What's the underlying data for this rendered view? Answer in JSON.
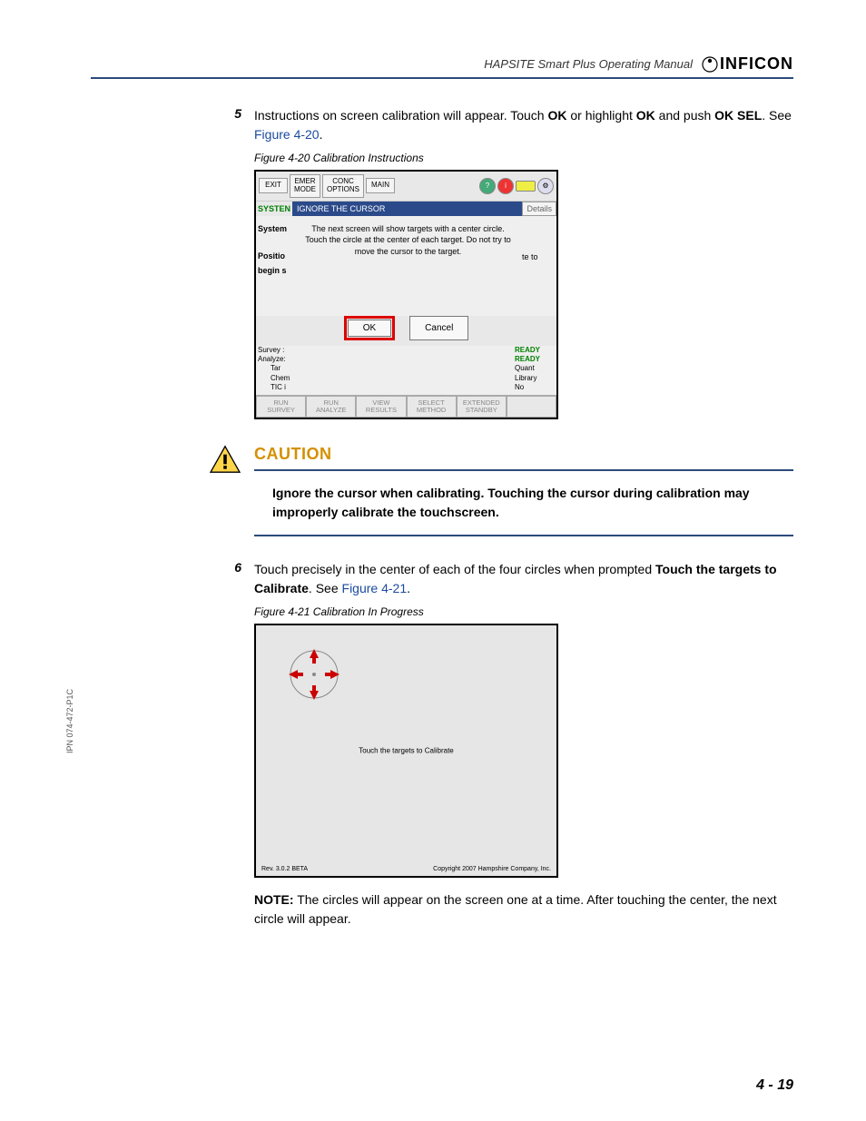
{
  "header": {
    "manual_title": "HAPSITE Smart Plus Operating Manual",
    "logo_text": "INFICON"
  },
  "step5": {
    "num": "5",
    "text_before": "Instructions on screen calibration will appear. Touch ",
    "bold1": "OK",
    "text_mid1": " or highlight ",
    "bold2": "OK",
    "text_mid2": " and push ",
    "bold3": "OK SEL",
    "text_end": ". See ",
    "ref": "Figure 4-20",
    "period": "."
  },
  "fig20_caption": "Figure 4-20  Calibration Instructions",
  "shot1": {
    "top": {
      "exit": "EXIT",
      "emer": "EMER\nMODE",
      "conc": "CONC\nOPTIONS",
      "main": "MAIN"
    },
    "systen": "SYSTEN",
    "ignore": "IGNORE THE CURSOR",
    "details": "Details",
    "left": {
      "l1": "System",
      "l2": "Positio",
      "l3": "begin s"
    },
    "msg": "The next screen will show targets with a center circle. Touch the circle at the center of each target. Do not try to move the cursor to the target.",
    "right_frag": "te to",
    "ok": "OK",
    "cancel": "Cancel",
    "status": {
      "survey": "Survey :",
      "analyze": "Analyze:",
      "tar": "Tar",
      "chem": "Chem",
      "tic": "TIC i",
      "ready1": "READY",
      "ready2": "READY",
      "quant": "Quant",
      "library": "Library",
      "no": "No"
    },
    "bottom": {
      "b1": "RUN\nSURVEY",
      "b2": "RUN\nANALYZE",
      "b3": "VIEW\nRESULTS",
      "b4": "SELECT\nMETHOD",
      "b5": "EXTENDED\nSTANDBY"
    }
  },
  "caution": {
    "title": "CAUTION",
    "text": "Ignore the cursor when calibrating. Touching the cursor during calibration may improperly calibrate the touchscreen."
  },
  "step6": {
    "num": "6",
    "text_before": "Touch precisely in the center of each of the four circles when prompted ",
    "bold1": "Touch the targets to Calibrate",
    "text_end": ". See ",
    "ref": "Figure 4-21",
    "period": "."
  },
  "fig21_caption": "Figure 4-21  Calibration In Progress",
  "shot2": {
    "center": "Touch the targets to Calibrate",
    "rev": "Rev. 3.0.2 BETA",
    "copy": "Copyright 2007 Hampshire Company, Inc."
  },
  "note": {
    "label": "NOTE:",
    "text": " The circles will appear on the screen one at a time. After touching the center, the next circle will appear."
  },
  "side_code": "IPN 074-472-P1C",
  "page_num": "4 - 19"
}
